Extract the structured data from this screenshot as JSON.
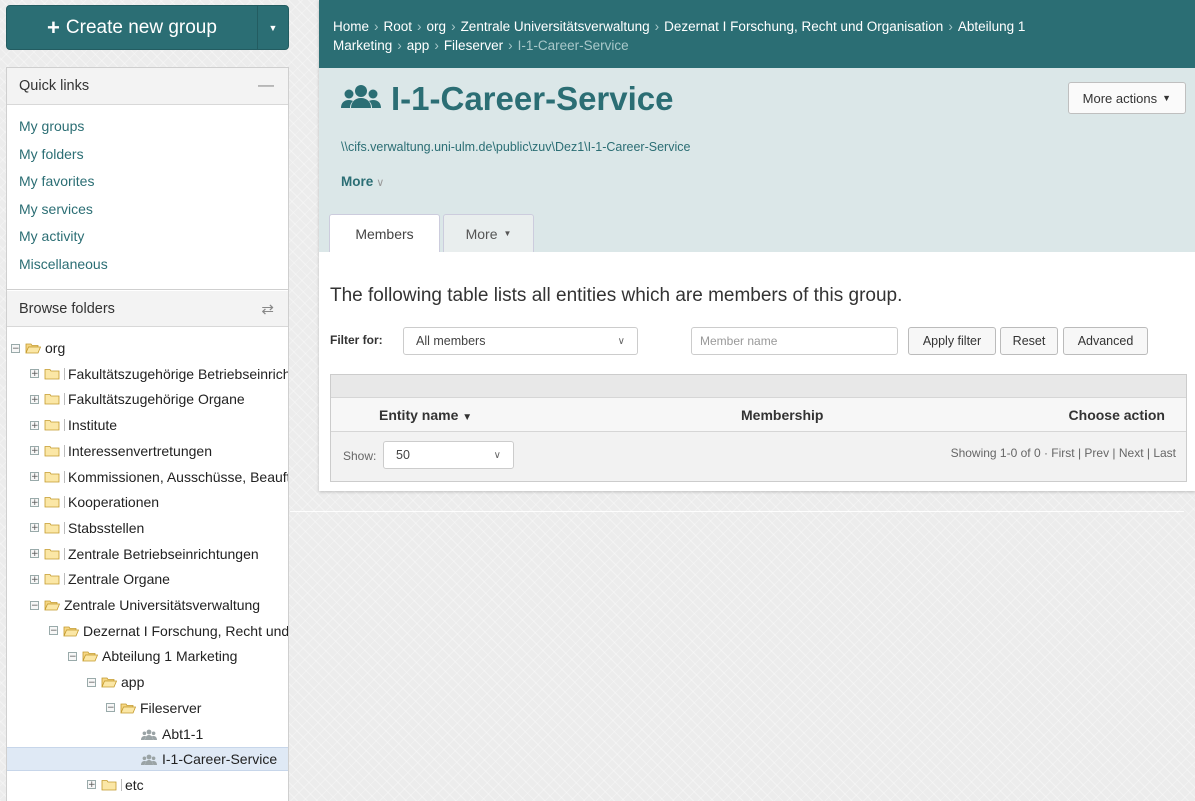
{
  "sidebar": {
    "create_button": "Create new group",
    "quick_links_title": "Quick links",
    "quick_links": [
      "My groups",
      "My folders",
      "My favorites",
      "My services",
      "My activity",
      "Miscellaneous"
    ],
    "browse_title": "Browse folders",
    "tree": [
      {
        "label": "org",
        "kind": "folder-open",
        "toggle": "-"
      },
      {
        "label": "Fakultätszugehörige Betriebseinrichtungen",
        "kind": "folder",
        "toggle": "+"
      },
      {
        "label": "Fakultätszugehörige Organe",
        "kind": "folder",
        "toggle": "+"
      },
      {
        "label": "Institute",
        "kind": "folder",
        "toggle": "+"
      },
      {
        "label": "Interessenvertretungen",
        "kind": "folder",
        "toggle": "+"
      },
      {
        "label": "Kommissionen, Ausschüsse, Beauftragte",
        "kind": "folder",
        "toggle": "+"
      },
      {
        "label": "Kooperationen",
        "kind": "folder",
        "toggle": "+"
      },
      {
        "label": "Stabsstellen",
        "kind": "folder",
        "toggle": "+"
      },
      {
        "label": "Zentrale Betriebseinrichtungen",
        "kind": "folder",
        "toggle": "+"
      },
      {
        "label": "Zentrale Organe",
        "kind": "folder",
        "toggle": "+"
      },
      {
        "label": "Zentrale Universitätsverwaltung",
        "kind": "folder-open",
        "toggle": "-"
      },
      {
        "label": "Dezernat I Forschung, Recht und Organisation",
        "kind": "folder-open",
        "toggle": "-"
      },
      {
        "label": "Abteilung 1 Marketing",
        "kind": "folder-open",
        "toggle": "-"
      },
      {
        "label": "app",
        "kind": "folder-open",
        "toggle": "-"
      },
      {
        "label": "Fileserver",
        "kind": "folder-open",
        "toggle": "-"
      },
      {
        "label": "Abt1-1",
        "kind": "group",
        "toggle": ""
      },
      {
        "label": "I-1-Career-Service",
        "kind": "group",
        "toggle": "",
        "selected": true
      },
      {
        "label": "etc",
        "kind": "folder",
        "toggle": "+"
      }
    ]
  },
  "breadcrumb": {
    "items": [
      "Home",
      "Root",
      "org",
      "Zentrale Universitätsverwaltung",
      "Dezernat I Forschung, Recht und Organisation",
      "Abteilung 1 Marketing",
      "app",
      "Fileserver"
    ],
    "current": "I-1-Career-Service"
  },
  "group": {
    "title": "I-1-Career-Service",
    "path": "\\\\cifs.verwaltung.uni-ulm.de\\public\\zuv\\Dez1\\I-1-Career-Service",
    "more_label": "More",
    "more_actions": "More actions"
  },
  "tabs": {
    "members": "Members",
    "more": "More"
  },
  "members": {
    "description": "The following table lists all entities which are members of this group.",
    "filter_label": "Filter for:",
    "filter_value": "All members",
    "member_placeholder": "Member name",
    "apply_filter": "Apply filter",
    "reset": "Reset",
    "advanced": "Advanced",
    "columns": [
      "Entity name",
      "Membership",
      "Choose action"
    ],
    "show_label": "Show:",
    "show_value": "50",
    "paging_text": "Showing 1-0 of 0 · First | Prev | Next | Last"
  },
  "colors": {
    "accent": "#2b6e74",
    "header_bg": "#dbe7e8"
  }
}
